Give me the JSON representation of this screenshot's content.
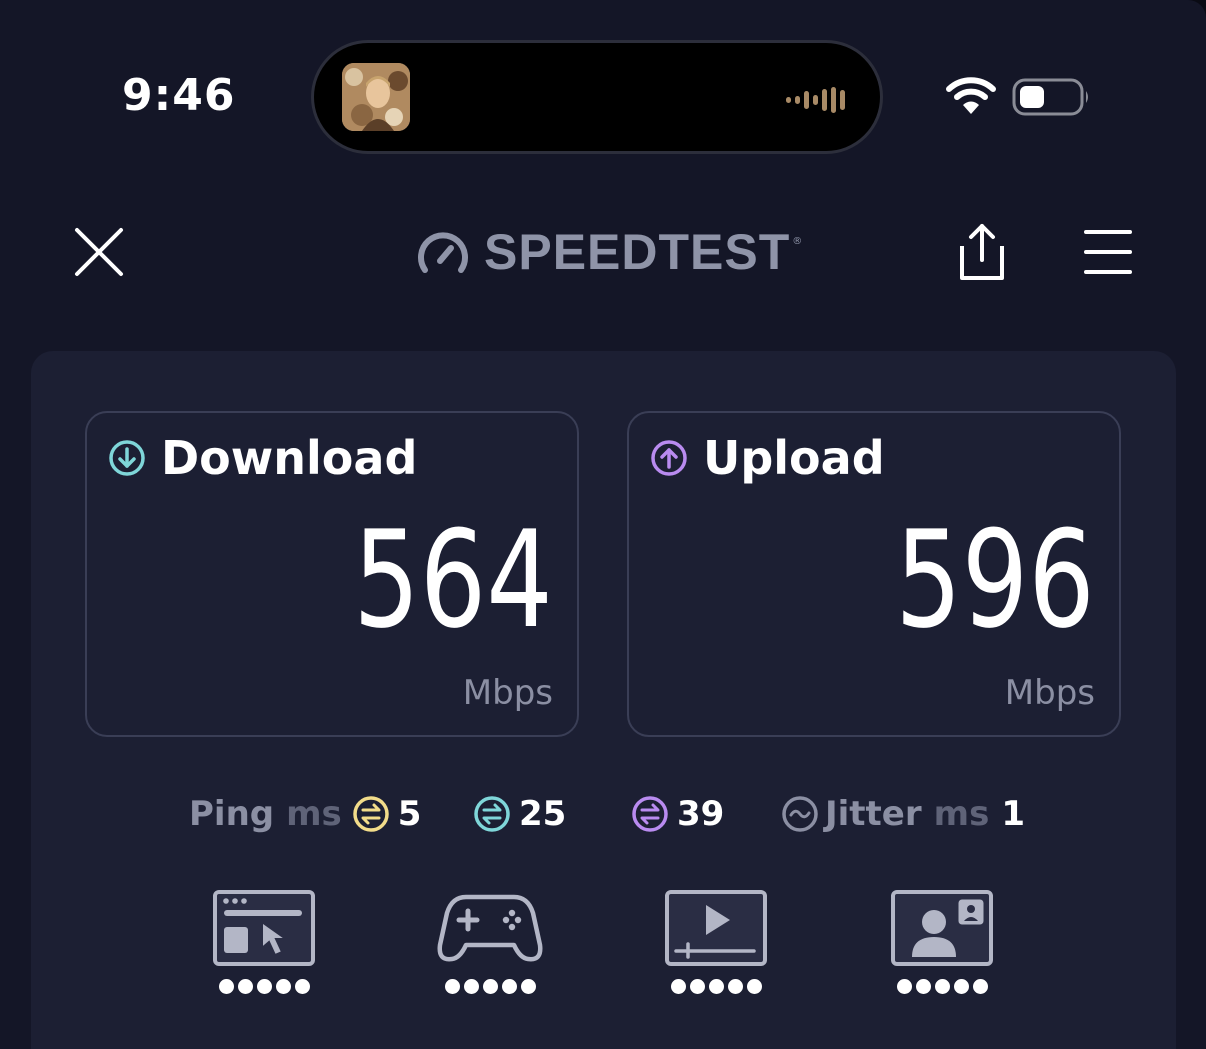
{
  "status_bar": {
    "time": "9:46",
    "icons": [
      "now-playing-thumbnail",
      "audio-waveform-icon",
      "wifi-icon",
      "battery-icon"
    ]
  },
  "header": {
    "brand": "SPEEDTEST",
    "trademark": "®",
    "icons": [
      "close-icon",
      "speedometer-icon",
      "share-icon",
      "menu-icon"
    ]
  },
  "results": {
    "download": {
      "label": "Download",
      "value": "564",
      "unit": "Mbps",
      "icon": "arrow-down-circle-icon",
      "color": "#7fd6d9"
    },
    "upload": {
      "label": "Upload",
      "value": "596",
      "unit": "Mbps",
      "icon": "arrow-up-circle-icon",
      "color": "#b98bf0"
    }
  },
  "ping": {
    "label": "Ping",
    "unit": "ms",
    "idle": {
      "value": "5",
      "color": "#f2dc8a",
      "icon": "ping-idle-icon"
    },
    "download": {
      "value": "25",
      "color": "#7fd6d9",
      "icon": "ping-download-icon"
    },
    "upload": {
      "value": "39",
      "color": "#b98bf0",
      "icon": "ping-upload-icon"
    }
  },
  "jitter": {
    "label": "Jitter",
    "unit": "ms",
    "value": "1",
    "icon": "jitter-wave-icon"
  },
  "usage_ratings": [
    {
      "name": "web-browsing",
      "icon": "browser-cursor-icon",
      "rating": 5,
      "max": 5
    },
    {
      "name": "gaming",
      "icon": "gamepad-icon",
      "rating": 5,
      "max": 5
    },
    {
      "name": "video-streaming",
      "icon": "video-player-icon",
      "rating": 5,
      "max": 5
    },
    {
      "name": "video-chat",
      "icon": "video-call-icon",
      "rating": 5,
      "max": 5
    }
  ]
}
